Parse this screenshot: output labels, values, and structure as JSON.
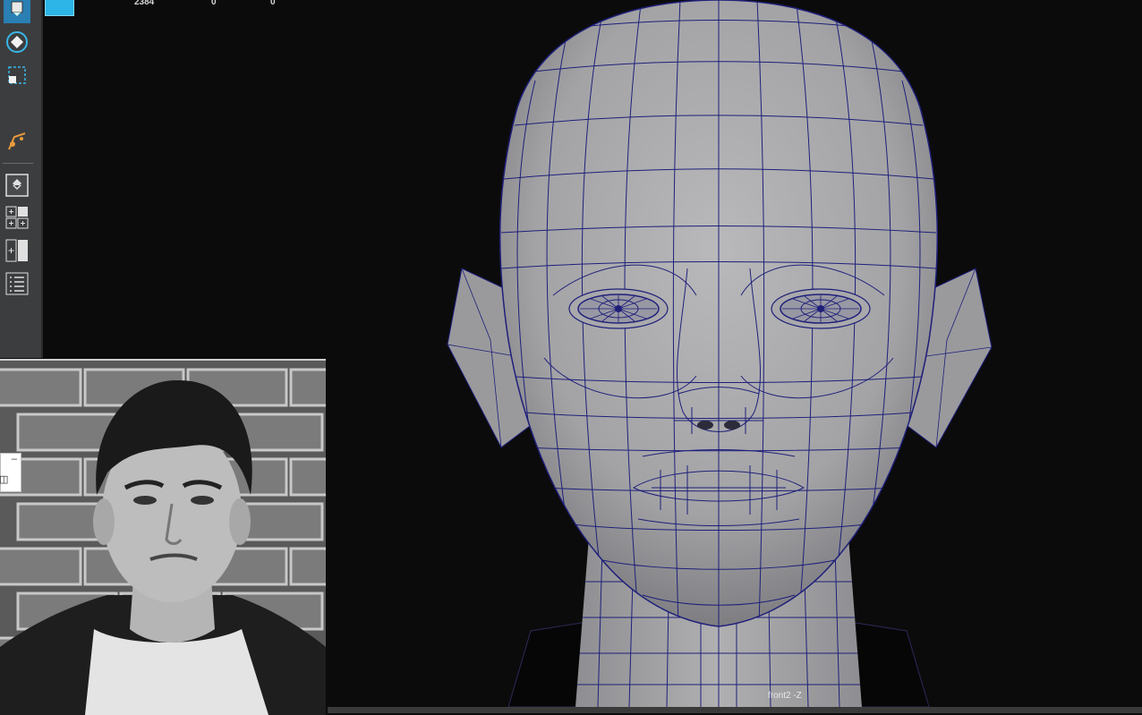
{
  "hud": {
    "values": [
      "2384",
      "0",
      "0"
    ]
  },
  "viewport": {
    "camera_label": "front2 -Z"
  },
  "mini_window": {
    "minimize_glyph": "–",
    "icon_glyph": "◫"
  },
  "toolbar": {
    "tools": [
      "move-tool-icon",
      "rotate-tool-icon",
      "scale-tool-icon",
      "soft-select-icon",
      "single-view-layout-icon",
      "four-view-layout-icon",
      "two-view-layout-icon",
      "outliner-layout-icon"
    ]
  },
  "colors": {
    "viewport_bg": "#0b0b0c",
    "toolbar_bg": "#3c3d3f",
    "wireframe": "#1f1f7a",
    "mesh": "#a6a6a8",
    "selection": "#2db5e8"
  }
}
